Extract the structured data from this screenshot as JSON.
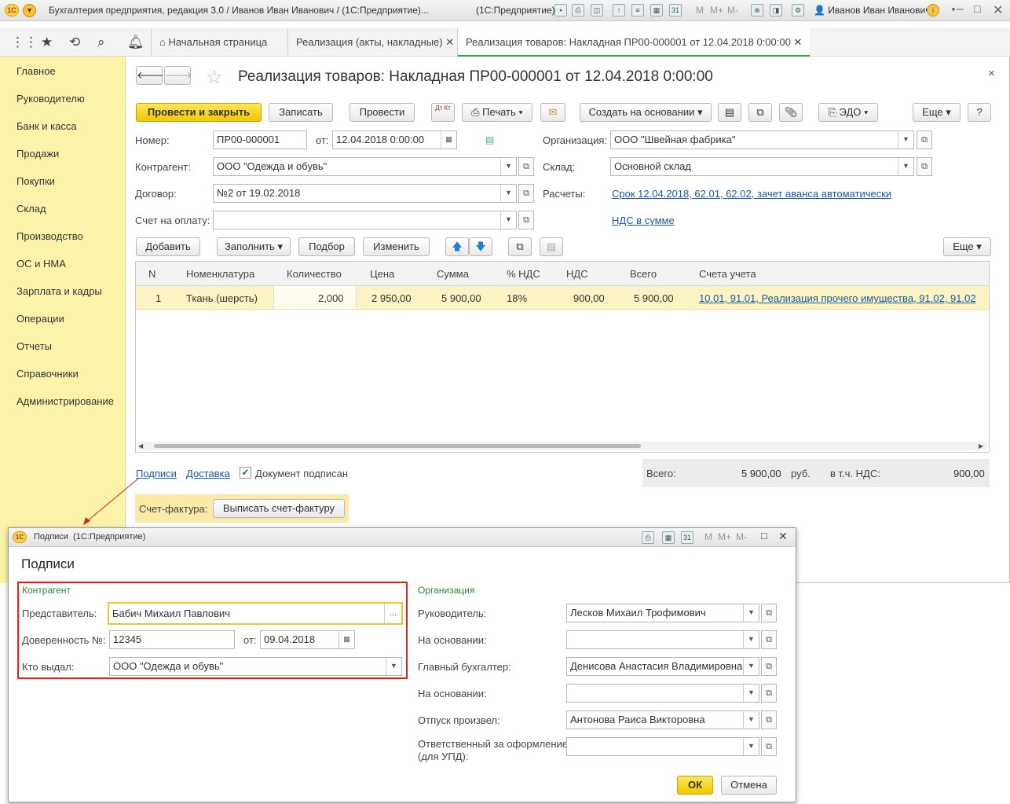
{
  "window": {
    "title": "Бухгалтерия предприятия, редакция 3.0 / Иванов Иван Иванович / (1С:Предприятие)...",
    "app_suffix": "(1С:Предприятие)",
    "user": "Иванов Иван Иванович",
    "logo": "1С",
    "toolbar_m": "M",
    "toolbar_mplus": "M+",
    "toolbar_mminus": "M-"
  },
  "tabs": [
    {
      "label": "Начальная страница"
    },
    {
      "label": "Реализация (акты, накладные)"
    },
    {
      "label": "Реализация товаров: Накладная ПР00-000001 от 12.04.2018 0:00:00"
    }
  ],
  "sidebar": {
    "items": [
      {
        "label": "Главное"
      },
      {
        "label": "Руководителю"
      },
      {
        "label": "Банк и касса"
      },
      {
        "label": "Продажи"
      },
      {
        "label": "Покупки"
      },
      {
        "label": "Склад"
      },
      {
        "label": "Производство"
      },
      {
        "label": "ОС и НМА"
      },
      {
        "label": "Зарплата и кадры"
      },
      {
        "label": "Операции"
      },
      {
        "label": "Отчеты"
      },
      {
        "label": "Справочники"
      },
      {
        "label": "Администрирование"
      }
    ]
  },
  "doc": {
    "title": "Реализация товаров: Накладная ПР00-000001 от 12.04.2018 0:00:00",
    "toolbar": {
      "post_close": "Провести и закрыть",
      "save": "Записать",
      "post": "Провести",
      "dtkt": "Дт Кт",
      "print": "Печать",
      "create_based": "Создать на основании",
      "edo": "ЭДО",
      "more": "Еще",
      "help": "?"
    },
    "number_label": "Номер:",
    "number": "ПР00-000001",
    "date_label": "от:",
    "date": "12.04.2018  0:00:00",
    "org_label": "Организация:",
    "org": "ООО \"Швейная фабрика\"",
    "counterparty_label": "Контрагент:",
    "counterparty": "ООО \"Одежда и обувь\"",
    "warehouse_label": "Склад:",
    "warehouse": "Основной склад",
    "contract_label": "Договор:",
    "contract": "№2 от 19.02.2018",
    "settlements_label": "Расчеты:",
    "settlements_link": "Срок 12.04.2018, 62.01, 62.02, зачет аванса автоматически",
    "invoice_label": "Счет на оплату:",
    "invoice": "",
    "vat_link": "НДС в сумме"
  },
  "table_toolbar": {
    "add": "Добавить",
    "fill": "Заполнить",
    "pick": "Подбор",
    "change": "Изменить",
    "more": "Еще"
  },
  "table": {
    "columns": [
      "N",
      "Номенклатура",
      "Количество",
      "Цена",
      "Сумма",
      "% НДС",
      "НДС",
      "Всего",
      "Счета учета"
    ],
    "rows": [
      {
        "n": "1",
        "item": "Ткань (шерсть)",
        "qty": "2,000",
        "price": "2 950,00",
        "sum": "5 900,00",
        "vat_rate": "18%",
        "vat": "900,00",
        "total": "5 900,00",
        "accounts": "10.01, 91.01, Реализация прочего имущества, 91.02, 91.02"
      }
    ]
  },
  "footer": {
    "signatures_link": "Подписи",
    "delivery_link": "Доставка",
    "signed_label": "Документ подписан",
    "total_label": "Всего:",
    "total_value": "5 900,00",
    "currency": "руб.",
    "vat_label": "в т.ч. НДС:",
    "vat_value": "900,00",
    "invoice_label": "Счет-фактура:",
    "invoice_button": "Выписать счет-фактуру"
  },
  "dialog": {
    "window_title": "Подписи  (1С:Предприятие)",
    "heading": "Подписи",
    "counterparty_section": "Контрагент",
    "rep_label": "Представитель:",
    "rep_value": "Бабич Михаил Павлович",
    "proxy_label": "Доверенность №:",
    "proxy_value": "12345",
    "proxy_date_label": "от:",
    "proxy_date": "09.04.2018",
    "issued_label": "Кто выдал:",
    "issued_value": "ООО \"Одежда и обувь\"",
    "org_section": "Организация",
    "head_label": "Руководитель:",
    "head_value": "Лесков Михаил Трофимович",
    "basis1_label": "На основании:",
    "basis1_value": "",
    "accountant_label": "Главный бухгалтер:",
    "accountant_value": "Денисова Анастасия Владимировна",
    "basis2_label": "На основании:",
    "basis2_value": "",
    "released_label": "Отпуск произвел:",
    "released_value": "Антонова Раиса Викторовна",
    "responsible_label1": "Ответственный за оформление",
    "responsible_label2": "(для УПД):",
    "responsible_value": "",
    "ok": "ОК",
    "cancel": "Отмена"
  },
  "colors": {
    "sidebar_bg": "#fbf3a9",
    "accent_yellow": "#f2c800",
    "link": "#1a5aa6",
    "selected_row": "#fbf3c4",
    "highlight_frame": "#d9261c",
    "section_green": "#2a8a3a"
  }
}
